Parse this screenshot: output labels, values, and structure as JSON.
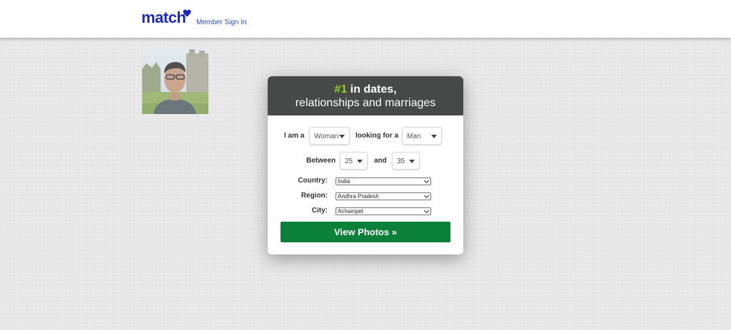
{
  "header": {
    "logo_text": "match",
    "sign_in_label": "Member Sign In",
    "brand_color": "#1f28b8"
  },
  "profile_photo": {
    "icon": "person-photo"
  },
  "card": {
    "headline_accent": "#1",
    "headline_rest": " in dates,",
    "subheadline": "relationships and marriages",
    "accent_color": "#8ed41f",
    "header_bg": "#464948",
    "i_am_label": "I am a",
    "i_am_value": "Woman",
    "looking_for_label": "looking for a",
    "looking_for_value": "Man",
    "between_label": "Between",
    "age_min": "25",
    "and_label": "and",
    "age_max": "35",
    "country_label": "Country:",
    "country_value": "India",
    "region_label": "Region:",
    "region_value": "Andhra Pradesh",
    "city_label": "City:",
    "city_value": "Achampet",
    "cta_label": "View Photos »",
    "cta_color": "#0a8039"
  }
}
